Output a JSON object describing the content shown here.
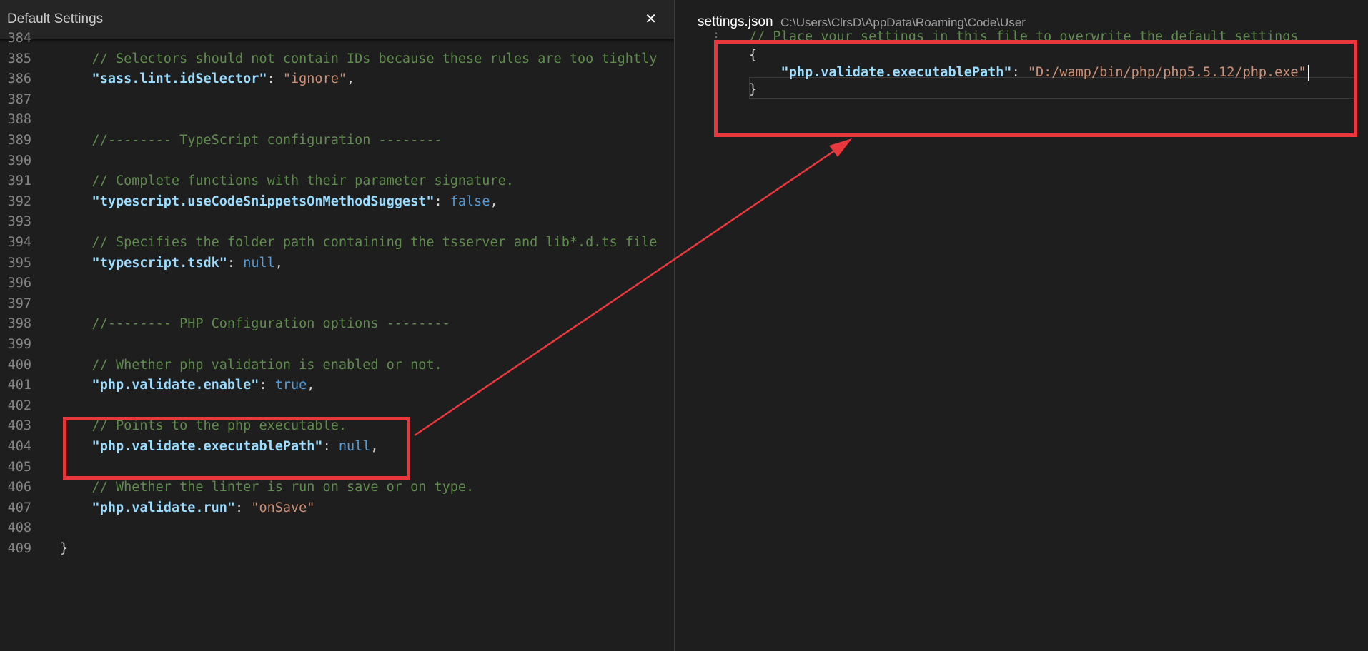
{
  "left_pane": {
    "title": "Default Settings",
    "close_glyph": "✕",
    "lines": [
      {
        "n": "384",
        "parts": []
      },
      {
        "n": "385",
        "parts": [
          {
            "t": "    // Selectors should not contain IDs because these rules are too tightly",
            "c": "comment"
          }
        ]
      },
      {
        "n": "386",
        "parts": [
          {
            "t": "    \"sass.lint.idSelector\"",
            "c": "key"
          },
          {
            "t": ": ",
            "c": "punc"
          },
          {
            "t": "\"ignore\"",
            "c": "str"
          },
          {
            "t": ",",
            "c": "punc"
          }
        ]
      },
      {
        "n": "387",
        "parts": []
      },
      {
        "n": "388",
        "parts": []
      },
      {
        "n": "389",
        "parts": [
          {
            "t": "    //-------- TypeScript configuration --------",
            "c": "comment"
          }
        ]
      },
      {
        "n": "390",
        "parts": []
      },
      {
        "n": "391",
        "parts": [
          {
            "t": "    // Complete functions with their parameter signature.",
            "c": "comment"
          }
        ]
      },
      {
        "n": "392",
        "parts": [
          {
            "t": "    \"typescript.useCodeSnippetsOnMethodSuggest\"",
            "c": "key"
          },
          {
            "t": ": ",
            "c": "punc"
          },
          {
            "t": "false",
            "c": "kw"
          },
          {
            "t": ",",
            "c": "punc"
          }
        ]
      },
      {
        "n": "393",
        "parts": []
      },
      {
        "n": "394",
        "parts": [
          {
            "t": "    // Specifies the folder path containing the tsserver and lib*.d.ts file",
            "c": "comment"
          }
        ]
      },
      {
        "n": "395",
        "parts": [
          {
            "t": "    \"typescript.tsdk\"",
            "c": "key"
          },
          {
            "t": ": ",
            "c": "punc"
          },
          {
            "t": "null",
            "c": "kw"
          },
          {
            "t": ",",
            "c": "punc"
          }
        ]
      },
      {
        "n": "396",
        "parts": []
      },
      {
        "n": "397",
        "parts": []
      },
      {
        "n": "398",
        "parts": [
          {
            "t": "    //-------- PHP Configuration options --------",
            "c": "comment"
          }
        ]
      },
      {
        "n": "399",
        "parts": []
      },
      {
        "n": "400",
        "parts": [
          {
            "t": "    // Whether php validation is enabled or not.",
            "c": "comment"
          }
        ]
      },
      {
        "n": "401",
        "parts": [
          {
            "t": "    \"php.validate.enable\"",
            "c": "key"
          },
          {
            "t": ": ",
            "c": "punc"
          },
          {
            "t": "true",
            "c": "kw"
          },
          {
            "t": ",",
            "c": "punc"
          }
        ]
      },
      {
        "n": "402",
        "parts": []
      },
      {
        "n": "403",
        "parts": [
          {
            "t": "    // Points to the php executable.",
            "c": "comment"
          }
        ]
      },
      {
        "n": "404",
        "parts": [
          {
            "t": "    \"php.validate.executablePath\"",
            "c": "key"
          },
          {
            "t": ": ",
            "c": "punc"
          },
          {
            "t": "null",
            "c": "kw"
          },
          {
            "t": ",",
            "c": "punc"
          }
        ]
      },
      {
        "n": "405",
        "parts": []
      },
      {
        "n": "406",
        "parts": [
          {
            "t": "    // Whether the linter is run on save or on type.",
            "c": "comment"
          }
        ]
      },
      {
        "n": "407",
        "parts": [
          {
            "t": "    \"php.validate.run\"",
            "c": "key"
          },
          {
            "t": ": ",
            "c": "punc"
          },
          {
            "t": "\"onSave\"",
            "c": "str"
          }
        ]
      },
      {
        "n": "408",
        "parts": []
      },
      {
        "n": "409",
        "parts": [
          {
            "t": "}",
            "c": "punc"
          }
        ]
      }
    ]
  },
  "right_pane": {
    "filename": "settings.json",
    "path": "C:\\Users\\ClrsD\\AppData\\Roaming\\Code\\User",
    "lines": [
      {
        "parts": [
          {
            "t": "// Place your settings in this file to overwrite the default settings",
            "c": "comment"
          }
        ]
      },
      {
        "parts": [
          {
            "t": "{",
            "c": "punc"
          }
        ]
      },
      {
        "parts": [
          {
            "t": "    \"php.validate.executablePath\"",
            "c": "key"
          },
          {
            "t": ": ",
            "c": "punc"
          },
          {
            "t": "\"D:/wamp/bin/php/php5.5.12/php.exe\"",
            "c": "str"
          }
        ]
      },
      {
        "parts": [
          {
            "t": "}",
            "c": "punc"
          }
        ]
      }
    ]
  },
  "annotation": {
    "color": "#e8383d"
  }
}
